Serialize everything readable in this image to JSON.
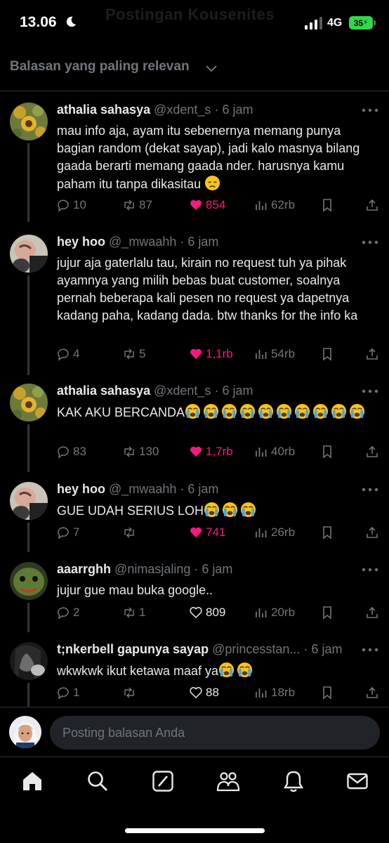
{
  "status_bar": {
    "time": "13.06",
    "network": "4G",
    "battery": "35",
    "ghost_title": "Postingan Kousenites"
  },
  "sort": {
    "label": "Balasan yang paling relevan"
  },
  "replies": [
    {
      "name": "athalia sahasya",
      "handle": "@xdent_s",
      "time": "· 6 jam",
      "text": "mau info aja, ayam itu sebenernya memang punya bagian random (dekat sayap), jadi kalo masnya bilang gaada berarti memang gaada nder. harusnya kamu paham itu tanpa dikasitau",
      "emojis": [
        "disappointed-face"
      ],
      "replies_count": "10",
      "reposts": "87",
      "likes": "854",
      "views": "62rb",
      "liked": true
    },
    {
      "name": "hey hoo",
      "handle": "@_mwaahh",
      "time": "· 6 jam",
      "text": "jujur aja gaterlalu tau, kirain no request tuh ya pihak ayamnya yang milih bebas buat customer, soalnya pernah beberapa kali pesen no request ya dapetnya kadang paha, kadang dada. btw thanks for the info ka",
      "emojis": [],
      "replies_count": "4",
      "reposts": "5",
      "likes": "1,1rb",
      "views": "54rb",
      "liked": true
    },
    {
      "name": "athalia sahasya",
      "handle": "@xdent_s",
      "time": "· 6 jam",
      "text": "KAK AKU BERCANDA",
      "emojis": [
        "loudly-crying-face",
        "loudly-crying-face",
        "loudly-crying-face",
        "loudly-crying-face",
        "loudly-crying-face",
        "loudly-crying-face",
        "loudly-crying-face",
        "loudly-crying-face",
        "loudly-crying-face",
        "loudly-crying-face"
      ],
      "replies_count": "83",
      "reposts": "130",
      "likes": "1,7rb",
      "views": "40rb",
      "liked": true
    },
    {
      "name": "hey hoo",
      "handle": "@_mwaahh",
      "time": "· 6 jam",
      "text": "GUE UDAH SERIUS LOH",
      "emojis": [
        "loudly-crying-face",
        "loudly-crying-face",
        "loudly-crying-face"
      ],
      "replies_count": "7",
      "reposts": "",
      "likes": "741",
      "views": "26rb",
      "liked": true
    },
    {
      "name": "aaarrghh",
      "handle": "@nimasjaling",
      "time": "· 6 jam",
      "text": "jujur gue mau buka google..",
      "emojis": [],
      "replies_count": "2",
      "reposts": "1",
      "likes": "809",
      "views": "20rb",
      "liked": false
    },
    {
      "name": "t;nkerbell gapunya sayap",
      "handle": "@princesstan...",
      "time": "· 6 jam",
      "text": "wkwkwk ikut ketawa maaf ya",
      "emojis": [
        "loudly-crying-face",
        "loudly-crying-face"
      ],
      "replies_count": "1",
      "reposts": "",
      "likes": "88",
      "views": "18rb",
      "liked": false
    }
  ],
  "composer": {
    "placeholder": "Posting balasan Anda"
  },
  "nav": [
    "home-icon",
    "search-icon",
    "grok-icon",
    "communities-icon",
    "notifications-icon",
    "messages-icon"
  ],
  "colors": {
    "accent_like": "#f91880",
    "muted": "#71767b",
    "text": "#e7e9ea",
    "bg": "#000000"
  }
}
